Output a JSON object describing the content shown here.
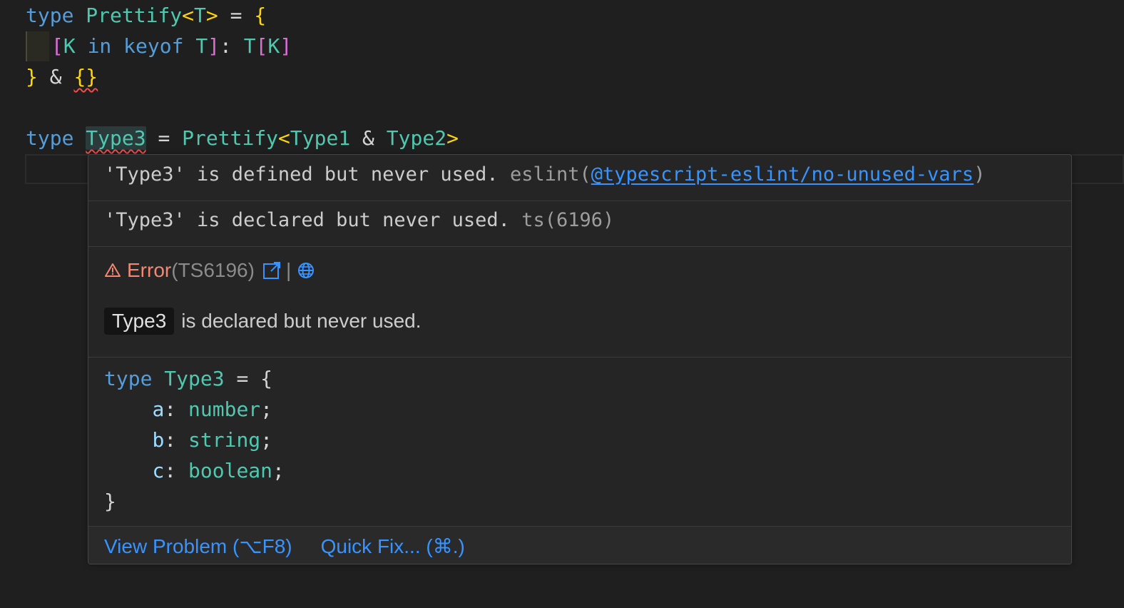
{
  "editor": {
    "lines": {
      "l1": {
        "kw": "type",
        "name": "Prettify",
        "lt": "<",
        "param": "T",
        "gt": ">",
        "eq": "=",
        "open": "{"
      },
      "l2": {
        "ob": "[",
        "k": "K",
        "in": "in",
        "keyof": "keyof",
        "t": "T",
        "cb": "]",
        "colon": ":",
        "t2": "T",
        "ob2": "[",
        "k2": "K",
        "cb2": "]"
      },
      "l3": {
        "close": "}",
        "amp": "&",
        "empty": "{}"
      },
      "l5": {
        "kw": "type",
        "name": "Type3",
        "eq": "=",
        "fn": "Prettify",
        "lt": "<",
        "a": "Type1",
        "amp": "&",
        "b": "Type2",
        "gt": ">"
      }
    }
  },
  "hover": {
    "eslint": {
      "message": "'Type3' is defined but never used.",
      "source": "eslint(",
      "rule": "@typescript-eslint/no-unused-vars",
      "source_close": ")"
    },
    "ts": {
      "message": "'Type3' is declared but never used.",
      "source": "ts(6196)"
    },
    "error": {
      "label": "Error",
      "code": "(TS6196)",
      "pipe": "|",
      "external_icon": "external-link-icon",
      "globe_icon": "globe-icon",
      "warning_icon": "warning-triangle-icon"
    },
    "description": {
      "code": "Type3",
      "text": "is declared but never used."
    },
    "expansion": {
      "kw": "type",
      "name": "Type3",
      "eq": "=",
      "open": "{",
      "props": [
        {
          "key": "a",
          "type": "number"
        },
        {
          "key": "b",
          "type": "string"
        },
        {
          "key": "c",
          "type": "boolean"
        }
      ],
      "close": "}"
    },
    "actions": {
      "view_problem": "View Problem (⌥F8)",
      "quick_fix": "Quick Fix... (⌘.)"
    }
  },
  "colors": {
    "background": "#1f1f1f",
    "hover_bg": "#252526",
    "keyword": "#569cd6",
    "type": "#4ec9b0",
    "link": "#3794ff",
    "error": "#f48771"
  }
}
